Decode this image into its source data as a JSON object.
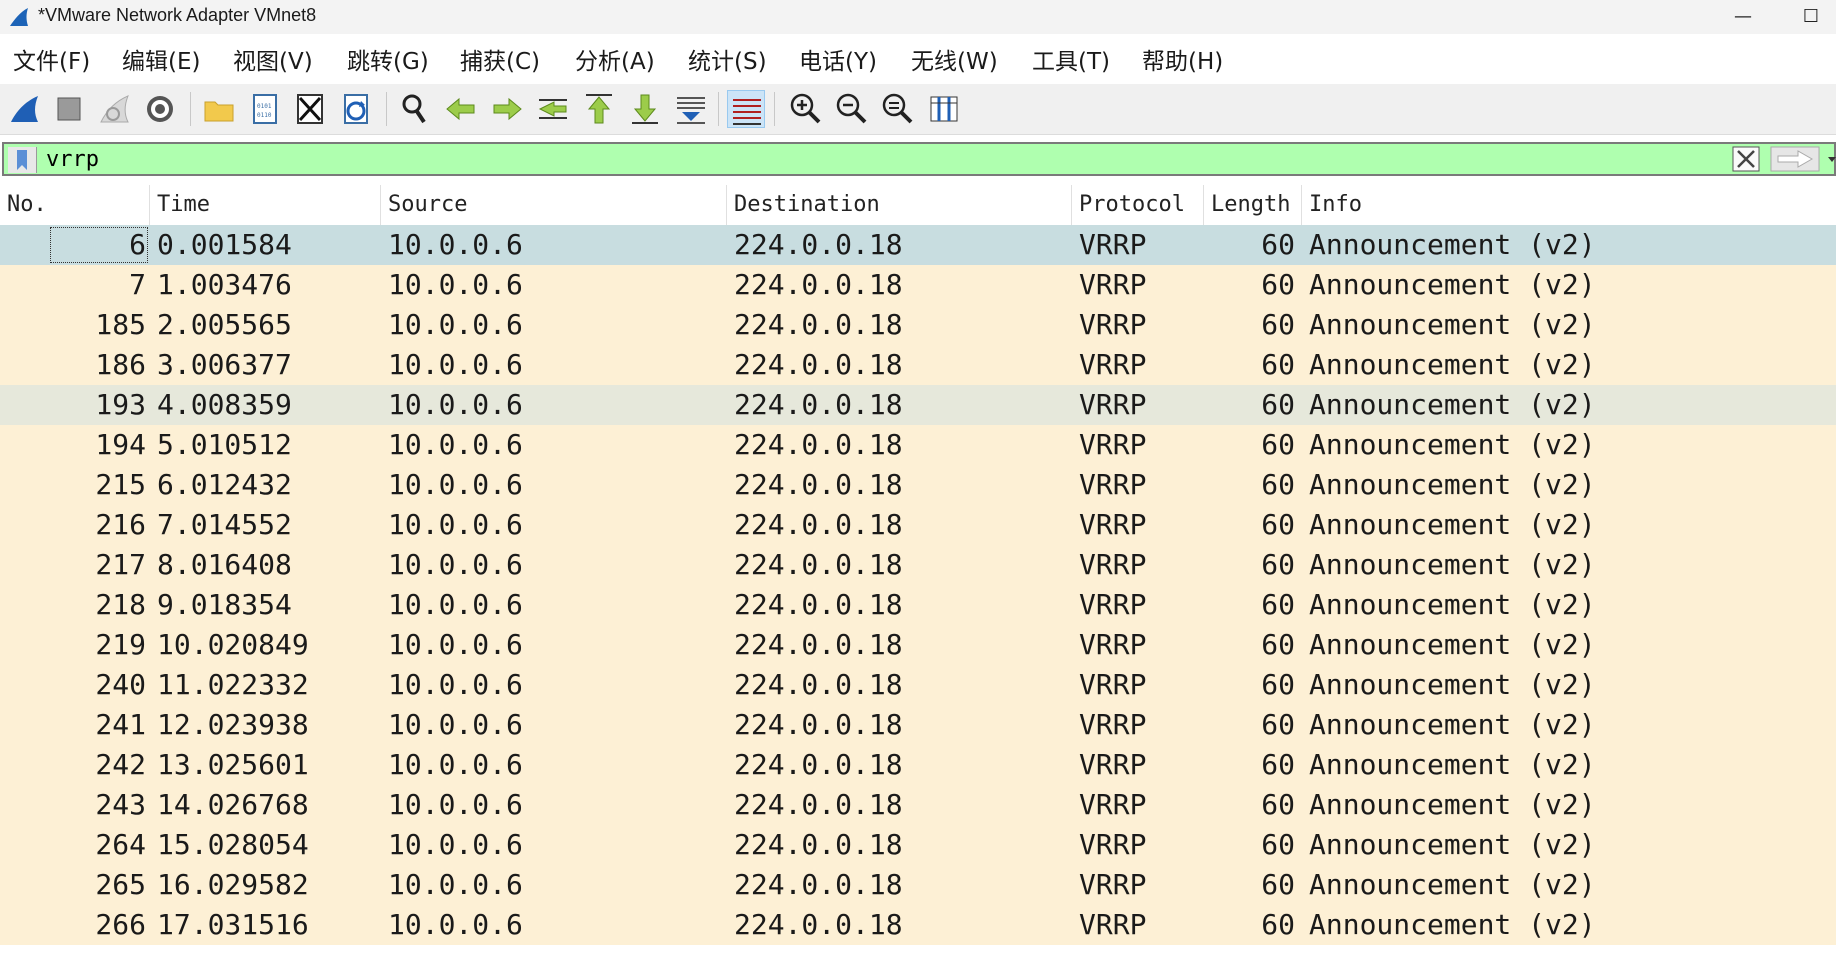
{
  "window": {
    "title": "*VMware Network Adapter VMnet8",
    "minimize_glyph": "—",
    "maximize_glyph": "☐"
  },
  "menu": [
    {
      "label": "文件(F)"
    },
    {
      "label": "编辑(E)"
    },
    {
      "label": "视图(V)"
    },
    {
      "label": "跳转(G)"
    },
    {
      "label": "捕获(C)"
    },
    {
      "label": "分析(A)"
    },
    {
      "label": "统计(S)"
    },
    {
      "label": "电话(Y)"
    },
    {
      "label": "无线(W)"
    },
    {
      "label": "工具(T)"
    },
    {
      "label": "帮助(H)"
    }
  ],
  "toolbar": {
    "buttons": [
      "start-capture-icon",
      "stop-capture-icon",
      "restart-capture-icon",
      "capture-options-icon",
      "open-file-icon",
      "save-file-icon",
      "close-file-icon",
      "reload-file-icon",
      "find-packet-icon",
      "go-back-icon",
      "go-forward-icon",
      "go-to-packet-icon",
      "first-packet-icon",
      "last-packet-icon",
      "autoscroll-icon",
      "colorize-icon",
      "zoom-in-icon",
      "zoom-out-icon",
      "zoom-normal-icon",
      "resize-columns-icon"
    ],
    "pressed": "colorize-icon"
  },
  "filter": {
    "value": "vrrp",
    "background": "#afffaf"
  },
  "columns": {
    "no": "No.",
    "time": "Time",
    "source": "Source",
    "destination": "Destination",
    "protocol": "Protocol",
    "length": "Length",
    "info": "Info"
  },
  "colors": {
    "row_default": "#fdf0d5",
    "row_selected": "#c8dde0",
    "row_hover": "#e6e8db"
  },
  "packets": [
    {
      "no": "6",
      "time": "0.001584",
      "source": "10.0.0.6",
      "destination": "224.0.0.18",
      "protocol": "VRRP",
      "length": "60",
      "info": "Announcement (v2)"
    },
    {
      "no": "7",
      "time": "1.003476",
      "source": "10.0.0.6",
      "destination": "224.0.0.18",
      "protocol": "VRRP",
      "length": "60",
      "info": "Announcement (v2)"
    },
    {
      "no": "185",
      "time": "2.005565",
      "source": "10.0.0.6",
      "destination": "224.0.0.18",
      "protocol": "VRRP",
      "length": "60",
      "info": "Announcement (v2)"
    },
    {
      "no": "186",
      "time": "3.006377",
      "source": "10.0.0.6",
      "destination": "224.0.0.18",
      "protocol": "VRRP",
      "length": "60",
      "info": "Announcement (v2)"
    },
    {
      "no": "193",
      "time": "4.008359",
      "source": "10.0.0.6",
      "destination": "224.0.0.18",
      "protocol": "VRRP",
      "length": "60",
      "info": "Announcement (v2)"
    },
    {
      "no": "194",
      "time": "5.010512",
      "source": "10.0.0.6",
      "destination": "224.0.0.18",
      "protocol": "VRRP",
      "length": "60",
      "info": "Announcement (v2)"
    },
    {
      "no": "215",
      "time": "6.012432",
      "source": "10.0.0.6",
      "destination": "224.0.0.18",
      "protocol": "VRRP",
      "length": "60",
      "info": "Announcement (v2)"
    },
    {
      "no": "216",
      "time": "7.014552",
      "source": "10.0.0.6",
      "destination": "224.0.0.18",
      "protocol": "VRRP",
      "length": "60",
      "info": "Announcement (v2)"
    },
    {
      "no": "217",
      "time": "8.016408",
      "source": "10.0.0.6",
      "destination": "224.0.0.18",
      "protocol": "VRRP",
      "length": "60",
      "info": "Announcement (v2)"
    },
    {
      "no": "218",
      "time": "9.018354",
      "source": "10.0.0.6",
      "destination": "224.0.0.18",
      "protocol": "VRRP",
      "length": "60",
      "info": "Announcement (v2)"
    },
    {
      "no": "219",
      "time": "10.020849",
      "source": "10.0.0.6",
      "destination": "224.0.0.18",
      "protocol": "VRRP",
      "length": "60",
      "info": "Announcement (v2)"
    },
    {
      "no": "240",
      "time": "11.022332",
      "source": "10.0.0.6",
      "destination": "224.0.0.18",
      "protocol": "VRRP",
      "length": "60",
      "info": "Announcement (v2)"
    },
    {
      "no": "241",
      "time": "12.023938",
      "source": "10.0.0.6",
      "destination": "224.0.0.18",
      "protocol": "VRRP",
      "length": "60",
      "info": "Announcement (v2)"
    },
    {
      "no": "242",
      "time": "13.025601",
      "source": "10.0.0.6",
      "destination": "224.0.0.18",
      "protocol": "VRRP",
      "length": "60",
      "info": "Announcement (v2)"
    },
    {
      "no": "243",
      "time": "14.026768",
      "source": "10.0.0.6",
      "destination": "224.0.0.18",
      "protocol": "VRRP",
      "length": "60",
      "info": "Announcement (v2)"
    },
    {
      "no": "264",
      "time": "15.028054",
      "source": "10.0.0.6",
      "destination": "224.0.0.18",
      "protocol": "VRRP",
      "length": "60",
      "info": "Announcement (v2)"
    },
    {
      "no": "265",
      "time": "16.029582",
      "source": "10.0.0.6",
      "destination": "224.0.0.18",
      "protocol": "VRRP",
      "length": "60",
      "info": "Announcement (v2)"
    },
    {
      "no": "266",
      "time": "17.031516",
      "source": "10.0.0.6",
      "destination": "224.0.0.18",
      "protocol": "VRRP",
      "length": "60",
      "info": "Announcement (v2)"
    }
  ],
  "selected_packet": "6",
  "hover_packet": "193"
}
